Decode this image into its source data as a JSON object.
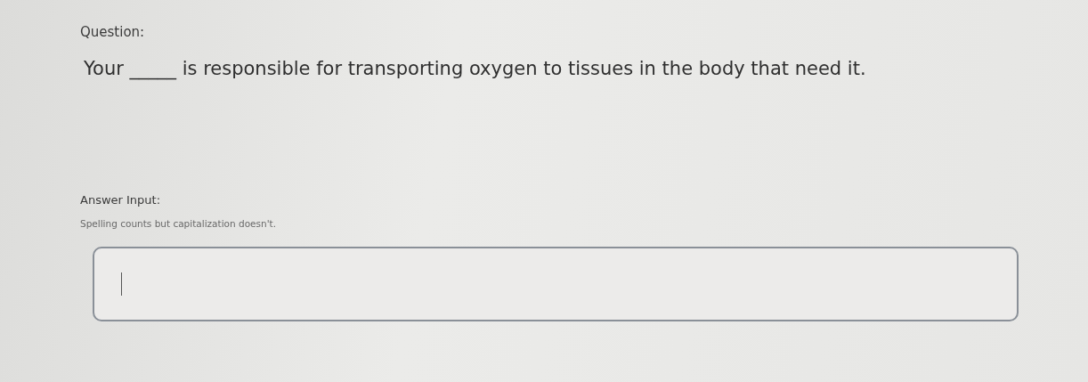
{
  "question": {
    "label": "Question:",
    "text": "Your _____ is responsible for transporting oxygen to tissues in the body that need it."
  },
  "answer": {
    "label": "Answer Input:",
    "hint": "Spelling counts but capitalization doesn't.",
    "focused": true
  }
}
